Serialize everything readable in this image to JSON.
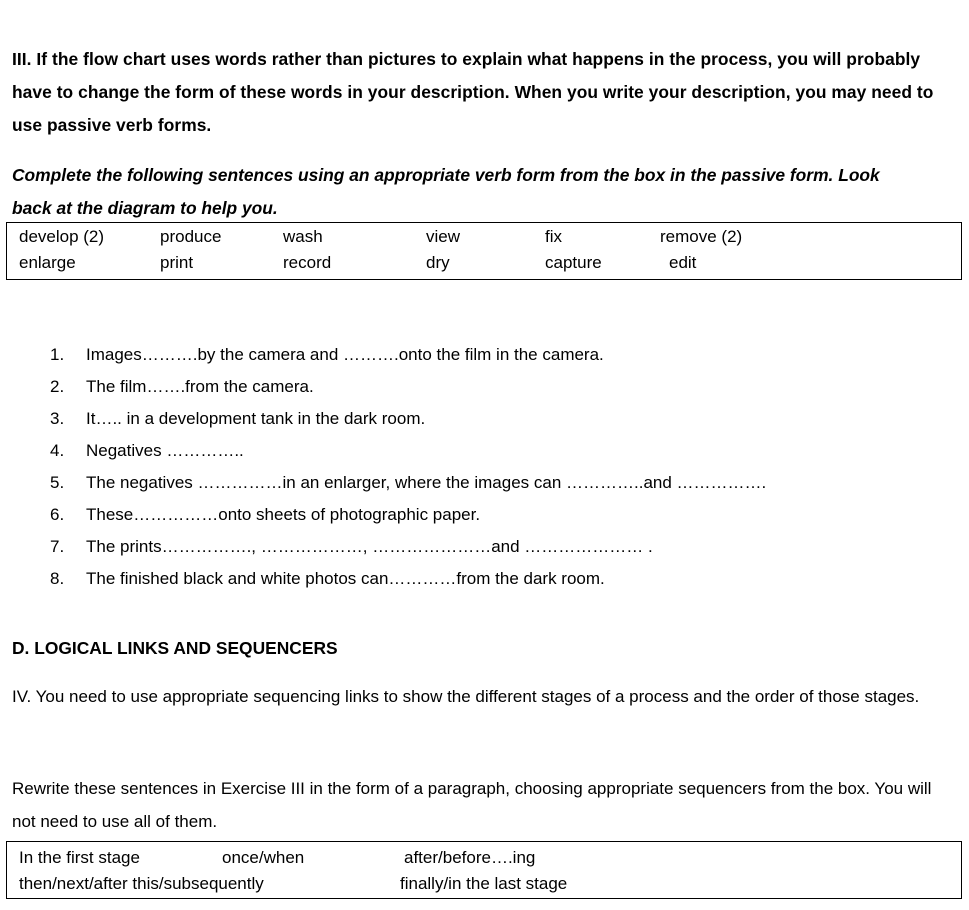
{
  "document": {
    "intro_paragraph": "III.  If the flow chart uses words rather than pictures to explain what happens in the process, you will probably have to change the form of these words in your description. When you write your description, you may need to use passive verb forms.",
    "instruction": "Complete the following sentences using an appropriate verb form from the box in the passive form. Look back at the diagram to help you.",
    "word_box": {
      "row1": [
        "develop (2)",
        "produce",
        "wash",
        "view",
        "fix",
        "remove (2)"
      ],
      "row2": [
        "enlarge",
        "print",
        "record",
        "dry",
        "capture",
        "edit"
      ]
    },
    "exercise_items": [
      {
        "number": "1.",
        "text": "Images……….by the camera and ……….onto the film in the camera."
      },
      {
        "number": "2.",
        "text": "The film…….from the camera."
      },
      {
        "number": "3.",
        "text": "It….. in a development tank in the dark room."
      },
      {
        "number": "4.",
        "text": "Negatives ………….."
      },
      {
        "number": "5.",
        "text": "The negatives ……………in an enlarger, where the images can …………..and ……………."
      },
      {
        "number": "6.",
        "text": "These……………onto sheets of photographic paper."
      },
      {
        "number": "7.",
        "text": "The prints……………., ………………, …………………and ………………… ."
      },
      {
        "number": "8.",
        "text": "The finished black and white photos can…………from the dark room."
      }
    ],
    "section_heading": "D.  LOGICAL LINKS AND SEQUENCERS",
    "paragraph_iv": "IV. You need to use appropriate sequencing links to show the different stages of a process and the order of those stages.",
    "paragraph_rewrite": "Rewrite these sentences in Exercise III in the form of a paragraph, choosing appropriate sequencers from the box. You will not need to use all of them.",
    "sequencer_box": {
      "row1": [
        "In the first stage",
        "once/when",
        "after/before….ing"
      ],
      "row2": [
        "then/next/after this/subsequently",
        "finally/in the last stage"
      ]
    },
    "colors": {
      "text": "#000000",
      "background": "#ffffff",
      "border": "#000000"
    }
  }
}
